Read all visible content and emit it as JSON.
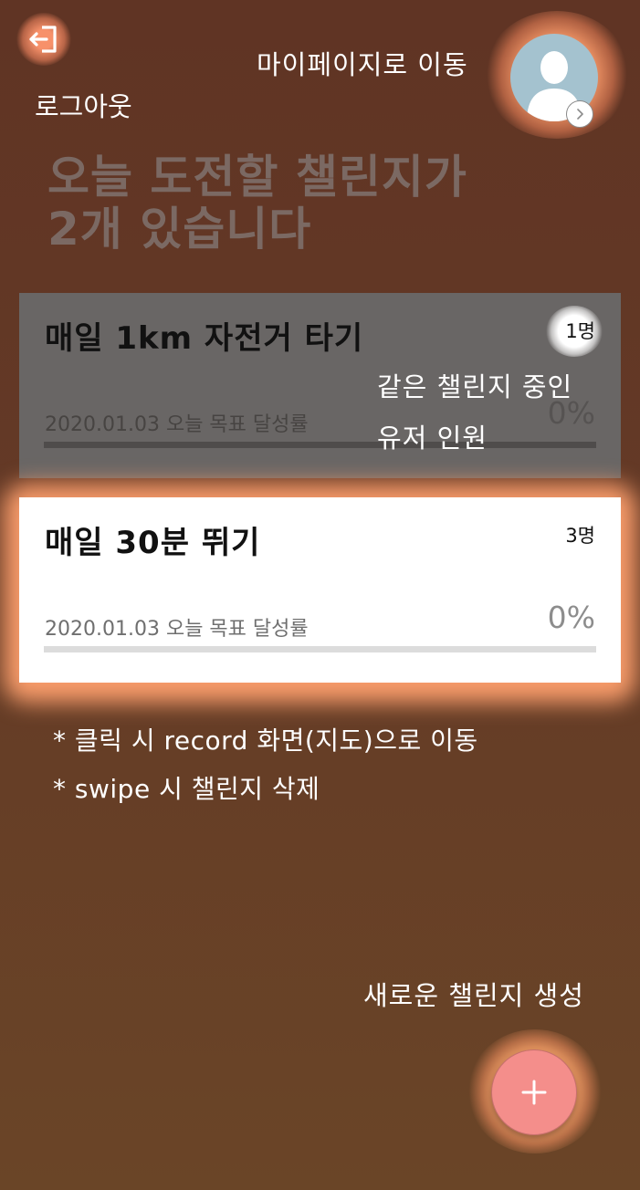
{
  "header": {
    "logout_label": "로그아웃",
    "mypage_label": "마이페이지로 이동",
    "logout_icon": "logout-icon",
    "avatar_icon": "user-avatar-icon"
  },
  "headline": {
    "line1": "오늘 도전할 챌린지가",
    "line2": "2개 있습니다"
  },
  "challenges": [
    {
      "title": "매일 1km 자전거 타기",
      "participants": "1명",
      "date_text": "2020.01.03 오늘 목표 달성률",
      "percent_text": "0%",
      "progress": 0
    },
    {
      "title": "매일 30분 뛰기",
      "participants": "3명",
      "date_text": "2020.01.03 오늘 목표 달성률",
      "percent_text": "0%",
      "progress": 0
    }
  ],
  "annotation": {
    "line1": "같은 챌린지 중인",
    "line2": "유저 인원"
  },
  "notes": [
    "* 클릭 시 record 화면(지도)으로 이동",
    "* swipe 시 챌린지 삭제"
  ],
  "new_challenge": {
    "label": "새로운 챌린지 생성",
    "button_icon": "plus-icon"
  },
  "colors": {
    "background_top": "#603424",
    "background_bottom": "#6a4527",
    "highlight_glow": "#ffa06e",
    "fab": "#f48e8b",
    "progress_fill": "#f79090"
  }
}
